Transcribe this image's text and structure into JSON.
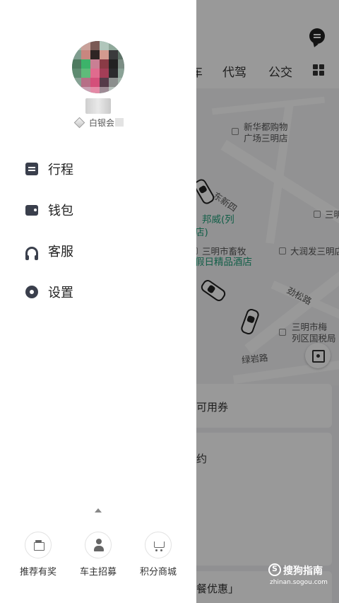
{
  "app": {
    "tabs": [
      "车",
      "代驾",
      "公交"
    ],
    "map_labels": {
      "poi_1_line1": "新华都购物",
      "poi_1_line2": "广场三明店",
      "road_1": "东新四",
      "hotel_name_1": "邦威(列",
      "hotel_name_2": "店)",
      "poi_2": "三明市畜牧",
      "hotel_3": "假日精品酒店",
      "poi_3": "大润发三明店",
      "poi_4": "三明",
      "road_2": "劲松路",
      "poi_5_line1": "三明市梅",
      "poi_5_line2": "列区国税局",
      "road_3": "绿岩路"
    },
    "cards": {
      "coupon": "可用券",
      "booking": "约",
      "meal": "餐优惠」"
    },
    "watermark": {
      "title": "搜狗指南",
      "subtitle": "zhinan.sogou.com"
    }
  },
  "drawer": {
    "member_level": "白银会",
    "menu": [
      {
        "label": "行程",
        "icon": "trip-icon"
      },
      {
        "label": "钱包",
        "icon": "wallet-icon"
      },
      {
        "label": "客服",
        "icon": "headset-icon"
      },
      {
        "label": "设置",
        "icon": "gear-icon"
      }
    ],
    "bottom_actions": [
      {
        "label": "推荐有奖",
        "icon": "gift-icon"
      },
      {
        "label": "车主招募",
        "icon": "driver-icon"
      },
      {
        "label": "积分商城",
        "icon": "cart-icon"
      }
    ]
  }
}
